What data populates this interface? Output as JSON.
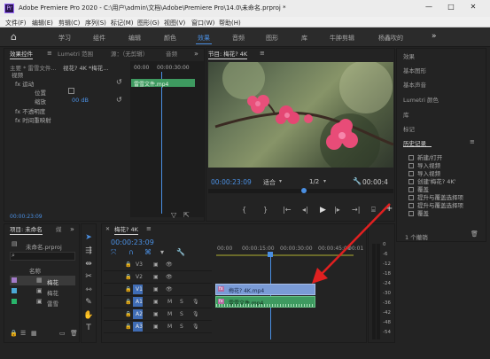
{
  "window": {
    "title": "Adobe Premiere Pro 2020 - C:\\用户\\admin\\文档\\Adobe\\Premiere Pro\\14.0\\未命名.prproj *",
    "min": "—",
    "max": "□",
    "close": "✕"
  },
  "menu": [
    "文件(F)",
    "编辑(E)",
    "剪辑(C)",
    "序列(S)",
    "标记(M)",
    "图形(G)",
    "视图(V)",
    "窗口(W)",
    "帮助(H)"
  ],
  "workspaces": {
    "home": "⌂",
    "tabs": [
      "学习",
      "组件",
      "编辑",
      "颜色",
      "效果",
      "音频",
      "图形",
      "库",
      "牛肿剪辑",
      "杨鑫吹的"
    ],
    "active_index": 4,
    "more": "»"
  },
  "source_panel": {
    "tabs": [
      "效果控件",
      "Lumetri 范围",
      "源：（无剪辑）",
      "音频"
    ],
    "menu": "≡",
    "more": "»",
    "master": "主要 * 雷雪文件...",
    "clip": "视花? 4K *梅花...",
    "timecode_left": "00:00",
    "timecode_right": "00:00:30:00",
    "clip_bar": "雷雪文件.mp4",
    "video_label": "视频",
    "sections": [
      "fx 运动",
      "fx 不透明度",
      "fx 时间重映射"
    ],
    "motion_props": [
      "位置",
      "缩放"
    ],
    "scale_value": "00 dB",
    "audio_label": "音频",
    "audio_section": "fx 音量",
    "bottom_time": "00:00:23:09"
  },
  "program": {
    "title": "节目: 梅花? 4K",
    "menu": "≡",
    "timecode": "00:00:23:09",
    "fit": "适合",
    "ratio": "1/2",
    "end_time": "00:00:4",
    "controls": {
      "mark_in": "{",
      "mark_out": "}",
      "go_in": "|←",
      "step_back": "◂|",
      "play": "▶",
      "step_fwd": "|▸",
      "go_out": "→|",
      "lift": "⬚",
      "extract": "⬚",
      "export": "⌸",
      "add": "+"
    }
  },
  "right_panel": {
    "items": [
      "效果",
      "基本图形",
      "基本声音",
      "Lumetri 颜色",
      "库",
      "标记"
    ],
    "history_title": "历史记录",
    "menu": "≡",
    "history": [
      "新建/打开",
      "导入视频",
      "导入视频",
      "创建'梅花? 4K'",
      "覆盖",
      "提升与覆盖选择项",
      "提升与覆盖选择项",
      "覆盖"
    ],
    "count": "1 个撤销",
    "trash": "🗑"
  },
  "project": {
    "tabs": [
      "项目: 未命名",
      "媒"
    ],
    "more": "»",
    "name": "未命名.prproj",
    "col_name": "名称",
    "items": [
      {
        "name": "梅花",
        "color": "#a37ac8"
      },
      {
        "name": "梅花",
        "color": "#4ba8d6"
      },
      {
        "name": "雷雪",
        "color": "#28b46a"
      }
    ],
    "colors": {
      "scissor": "#48b060",
      "blue": "#4a8fe2"
    }
  },
  "timeline": {
    "title": "梅花? 4K",
    "menu": "≡",
    "close": "✕",
    "timecode": "00:00:23:09",
    "ruler": [
      "00:00",
      "00:00:15:00",
      "00:00:30:00",
      "00:00:45:00",
      "00:01"
    ],
    "tracks": [
      {
        "label": "V3",
        "icons": "🔒 ▣ 👁"
      },
      {
        "label": "V2",
        "icons": "🔒 ▣ 👁"
      },
      {
        "label": "V1",
        "icons": "🔒 ▣ 👁"
      },
      {
        "label": "A1",
        "icons": "🔒 ▣ M S 🎙"
      },
      {
        "label": "A2",
        "icons": "🔒 ▣ M S 🎙"
      },
      {
        "label": "A3",
        "icons": "🔒 ▣ M S 🎙"
      }
    ],
    "clips": {
      "video": "梅花? 4K.mp4",
      "audio": "雷雪文件.mp4"
    },
    "db_scale": [
      "0",
      "-6",
      "-12",
      "-18",
      "-24",
      "-30",
      "-36",
      "-42",
      "-48",
      "-54"
    ],
    "colors": {
      "video": "#7a9bd6",
      "audio": "#3e9a60",
      "playhead": "#4a8fe2",
      "arrow": "#e02020"
    }
  }
}
